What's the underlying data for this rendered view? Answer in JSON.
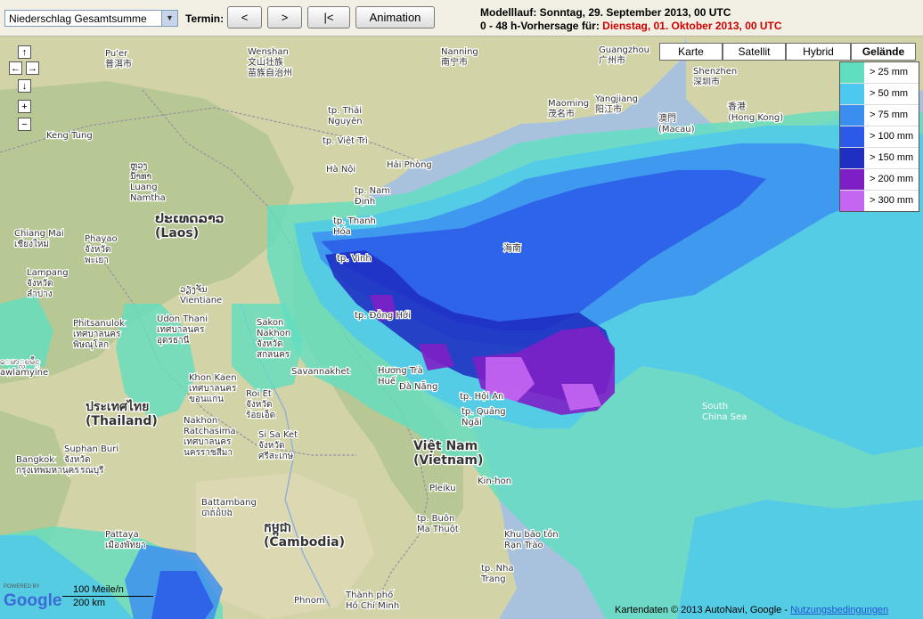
{
  "toolbar": {
    "product_select": "Niederschlag Gesamtsumme",
    "termin_label": "Termin:",
    "prev_button": "<",
    "next_button": ">",
    "first_button": "|<",
    "animation_button": "Animation",
    "model_run": "Modelllauf: Sonntag, 29. September 2013, 00 UTC",
    "forecast_prefix": "0 - 48 h-Vorhersage für:",
    "forecast_date": " Dienstag, 01. Oktober 2013, 00 UTC"
  },
  "map_types": [
    {
      "label": "Karte",
      "active": false
    },
    {
      "label": "Satellit",
      "active": false
    },
    {
      "label": "Hybrid",
      "active": false
    },
    {
      "label": "Gelände",
      "active": true
    }
  ],
  "legend": [
    {
      "label": "> 25 mm",
      "color": "#5fdfc0"
    },
    {
      "label": "> 50 mm",
      "color": "#4dc8ee"
    },
    {
      "label": "> 75 mm",
      "color": "#3a8ef0"
    },
    {
      "label": "> 100 mm",
      "color": "#2c5ae8"
    },
    {
      "label": "> 150 mm",
      "color": "#1f2fc2"
    },
    {
      "label": "> 200 mm",
      "color": "#7e1fc6"
    },
    {
      "label": "> 300 mm",
      "color": "#c466f2"
    }
  ],
  "nav": {
    "up": "↑",
    "left": "←",
    "right": "→",
    "down": "↓",
    "zoom_in": "+",
    "zoom_out": "−"
  },
  "places": [
    {
      "text": "Pu'er",
      "lines": [
        "Pu'er",
        "普洱市"
      ]
    },
    {
      "text": "Wenshan",
      "lines": [
        "Wenshan",
        "文山壮族",
        "苗族自治州"
      ]
    },
    {
      "text": "Nanning",
      "lines": [
        "Nanning",
        "南宁市"
      ]
    },
    {
      "text": "Guangzhou",
      "lines": [
        "Guangzhou",
        "广州市"
      ]
    },
    {
      "text": "Shenzhen",
      "lines": [
        "Shenzhen",
        "深圳市"
      ]
    },
    {
      "text": "Maoming",
      "lines": [
        "Maoming",
        "茂名市"
      ]
    },
    {
      "text": "Yangjiang",
      "lines": [
        "Yangjiang",
        "阳江市"
      ]
    },
    {
      "text": "Macau",
      "lines": [
        "澳門",
        "(Macau)"
      ]
    },
    {
      "text": "Hong Kong",
      "lines": [
        "香港",
        "(Hong Kong)"
      ]
    },
    {
      "text": "Hà Nội",
      "lines": [
        "Hà Nội"
      ]
    },
    {
      "text": "Hải Phòng",
      "lines": [
        "Hải Phòng"
      ]
    },
    {
      "text": "Thái Nguyên",
      "lines": [
        "tp. Thái",
        "Nguyên"
      ]
    },
    {
      "text": "Việt Trì",
      "lines": [
        "tp. Việt Trì"
      ]
    },
    {
      "text": "Nam Định",
      "lines": [
        "tp. Nam",
        "Định"
      ]
    },
    {
      "text": "Thanh Hóa",
      "lines": [
        "tp. Thanh",
        "Hóa"
      ]
    },
    {
      "text": "Vinh",
      "lines": [
        "tp. Vinh"
      ]
    },
    {
      "text": "Đồng Hới",
      "lines": [
        "tp. Đồng Hới"
      ]
    },
    {
      "text": "Hainan",
      "lines": [
        "海南"
      ]
    },
    {
      "text": "Laos",
      "lines": [
        "ປະເທດລາວ",
        "(Laos)"
      ]
    },
    {
      "text": "Luang Namtha",
      "lines": [
        "ຫຼວງ",
        "ນ້ຳທາ",
        "Luang",
        "Namtha"
      ]
    },
    {
      "text": "Kengtung",
      "lines": [
        "Keng Tung"
      ]
    },
    {
      "text": "Chiang Mai",
      "lines": [
        "Chiang Mai",
        "เชียงใหม่"
      ]
    },
    {
      "text": "Phayao",
      "lines": [
        "Phayao",
        "จังหวัด",
        "พะเยา"
      ]
    },
    {
      "text": "Lampang",
      "lines": [
        "Lampang",
        "จังหวัด",
        "ลำปาง"
      ]
    },
    {
      "text": "Vientiane",
      "lines": [
        "ວຽງຈັນ",
        "Vientiane"
      ]
    },
    {
      "text": "Udon Thani",
      "lines": [
        "Udon Thani",
        "เทศบาลนคร",
        "อุดรธานี"
      ]
    },
    {
      "text": "Sakon Nakhon",
      "lines": [
        "Sakon",
        "Nakhon",
        "จังหวัด",
        "สกลนคร"
      ]
    },
    {
      "text": "Phitsanulok",
      "lines": [
        "Phitsanulok",
        "เทศบาลนคร",
        "พิษณุโลก"
      ]
    },
    {
      "text": "Savannakhet",
      "lines": [
        "Savannakhet"
      ]
    },
    {
      "text": "Hue",
      "lines": [
        "Hương Trà",
        "Huế"
      ]
    },
    {
      "text": "Da Nang",
      "lines": [
        "Đà Nẵng"
      ]
    },
    {
      "text": "Hoi An",
      "lines": [
        "tp. Hội An"
      ]
    },
    {
      "text": "Quang Ngai",
      "lines": [
        "tp. Quảng",
        "Ngãi"
      ]
    },
    {
      "text": "Mawlamyine",
      "lines": [
        "ေမာ္လၿမိဳင္",
        "awlamyine"
      ]
    },
    {
      "text": "Thailand",
      "lines": [
        "ประเทศไทย",
        "(Thailand)"
      ]
    },
    {
      "text": "Khon Kaen",
      "lines": [
        "Khon Kaen",
        "เทศบาลนคร",
        "ขอนแก่น"
      ]
    },
    {
      "text": "Roi Et",
      "lines": [
        "Roi Et",
        "จังหวัด",
        "ร้อยเอ็ด"
      ]
    },
    {
      "text": "Nakhon Ratchasima",
      "lines": [
        "Nakhon",
        "Ratchasima",
        "เทศบาลนคร",
        "นครราชสีมา"
      ]
    },
    {
      "text": "Si Sa Ket",
      "lines": [
        "Si Sa Ket",
        "จังหวัด",
        "ศรีสะเกษ"
      ]
    },
    {
      "text": "Suphan Buri",
      "lines": [
        "Suphan Buri",
        "จังหวัด",
        "สุพรรณบุรี"
      ]
    },
    {
      "text": "Bangkok",
      "lines": [
        "Bangkok",
        "กรุงเทพมหานคร"
      ]
    },
    {
      "text": "Vietnam",
      "lines": [
        "Việt Nam",
        "(Vietnam)"
      ]
    },
    {
      "text": "Pleiku",
      "lines": [
        "Pleiku"
      ]
    },
    {
      "text": "Kin-hon",
      "lines": [
        "Kin-hon"
      ]
    },
    {
      "text": "South China Sea",
      "lines": [
        "South",
        "China Sea"
      ]
    },
    {
      "text": "Battambang",
      "lines": [
        "Battambang",
        "បាត់ដំបង"
      ]
    },
    {
      "text": "Cambodia",
      "lines": [
        "កម្ពុជា",
        "(Cambodia)"
      ]
    },
    {
      "text": "Buon Ma Thuot",
      "lines": [
        "tp. Buôn",
        "Ma Thuột"
      ]
    },
    {
      "text": "Khu bao ton",
      "lines": [
        "Khu bảo tồn",
        "Rạn Trào"
      ]
    },
    {
      "text": "Nha Trang",
      "lines": [
        "tp. Nha",
        "Trang"
      ]
    },
    {
      "text": "Pattaya",
      "lines": [
        "Pattaya",
        "เมืองพัทยา"
      ]
    },
    {
      "text": "Phnom",
      "lines": [
        "Phnom"
      ]
    },
    {
      "text": "HCMC",
      "lines": [
        "Thành phố",
        "Hồ Chí Minh"
      ]
    }
  ],
  "scale": {
    "miles": "100 Meile/n",
    "km": "200 km"
  },
  "attribution": {
    "text": "Kartendaten © 2013 AutoNavi, Google - ",
    "link": "Nutzungsbedingungen"
  },
  "google_logo": {
    "powered": "POWERED BY",
    "text": "Google"
  }
}
